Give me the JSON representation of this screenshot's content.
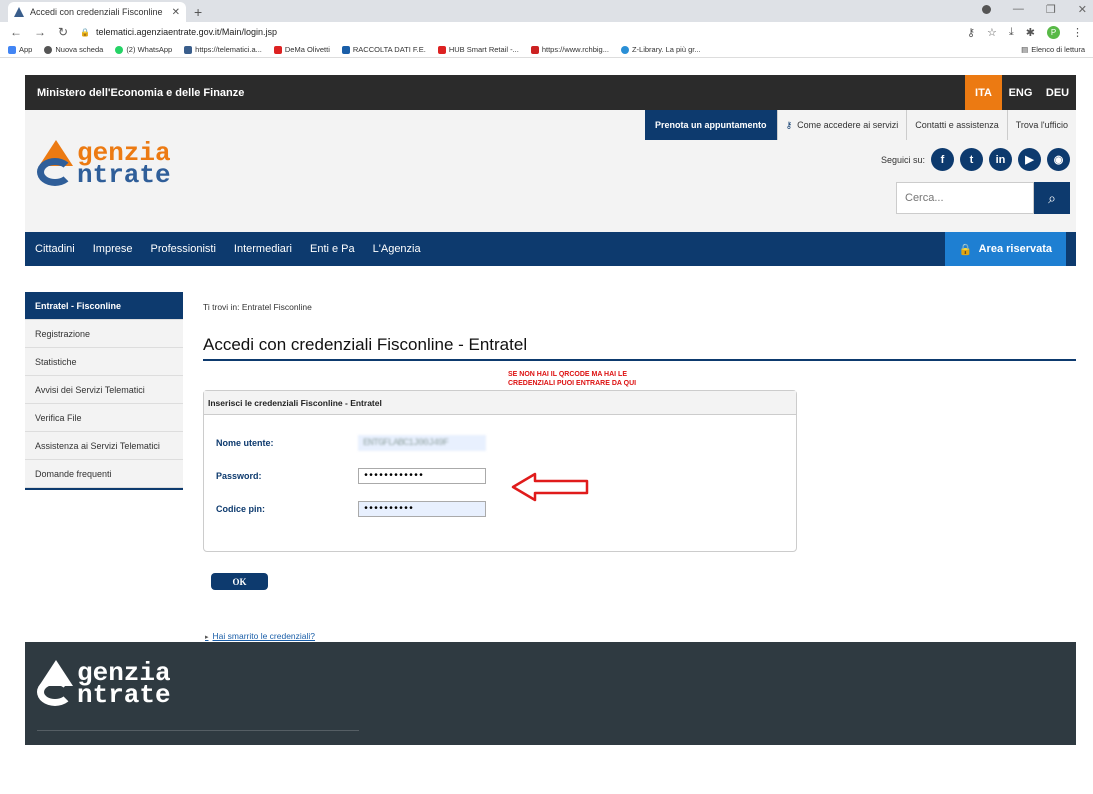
{
  "browser": {
    "tab_title": "Accedi con credenziali Fisconline",
    "url": "telematici.agenziaentrate.gov.it/Main/login.jsp",
    "bookmarks": [
      "App",
      "Nuova scheda",
      "(2) WhatsApp",
      "https://telematici.a...",
      "DeMa Olivetti",
      "RACCOLTA DATI F.E.",
      "HUB Smart Retail -...",
      "https://www.rchbig...",
      "Z-Library. La più gr..."
    ],
    "reading_list": "Elenco di lettura",
    "profile_initial": "P"
  },
  "site": {
    "ministry": "Ministero dell'Economia e delle Finanze",
    "langs": [
      "ITA",
      "ENG",
      "DEU"
    ],
    "logo_line1": "genzia",
    "logo_line2": "ntrate",
    "top_links": {
      "prenota": "Prenota un appuntamento",
      "come": "Come accedere ai servizi",
      "contatti": "Contatti e assistenza",
      "trova": "Trova l'ufficio"
    },
    "seguici": "Seguici su:",
    "search_placeholder": "Cerca...",
    "nav": [
      "Cittadini",
      "Imprese",
      "Professionisti",
      "Intermediari",
      "Enti e Pa",
      "L'Agenzia"
    ],
    "area_riservata": "Area riservata"
  },
  "sidebar": {
    "items": [
      "Entratel - Fisconline",
      "Registrazione",
      "Statistiche",
      "Avvisi dei Servizi Telematici",
      "Verifica File",
      "Assistenza ai Servizi Telematici",
      "Domande frequenti"
    ]
  },
  "main": {
    "breadcrumb": "Ti trovi in: Entratel Fisconline",
    "title": "Accedi con credenziali Fisconline - Entratel",
    "note_line1": "SE NON HAI IL QRCODE MA HAI LE",
    "note_line2": "CREDENZIALI PUOI ENTRARE DA QUI",
    "panel_title": "Inserisci le credenziali Fisconline - Entratel",
    "username_label": "Nome utente:",
    "username_value": "ENTGFLABC1J00J49F",
    "password_label": "Password:",
    "password_value": "••••••••••••",
    "pin_label": "Codice pin:",
    "pin_value": "••••••••••",
    "ok_label": "OK",
    "lost_link": "Hai smarrito le credenziali?"
  },
  "colors": {
    "navy": "#0d3a6e",
    "orange": "#ec7a12",
    "accent_blue": "#1e7fd2",
    "alert_red": "#d11111"
  }
}
